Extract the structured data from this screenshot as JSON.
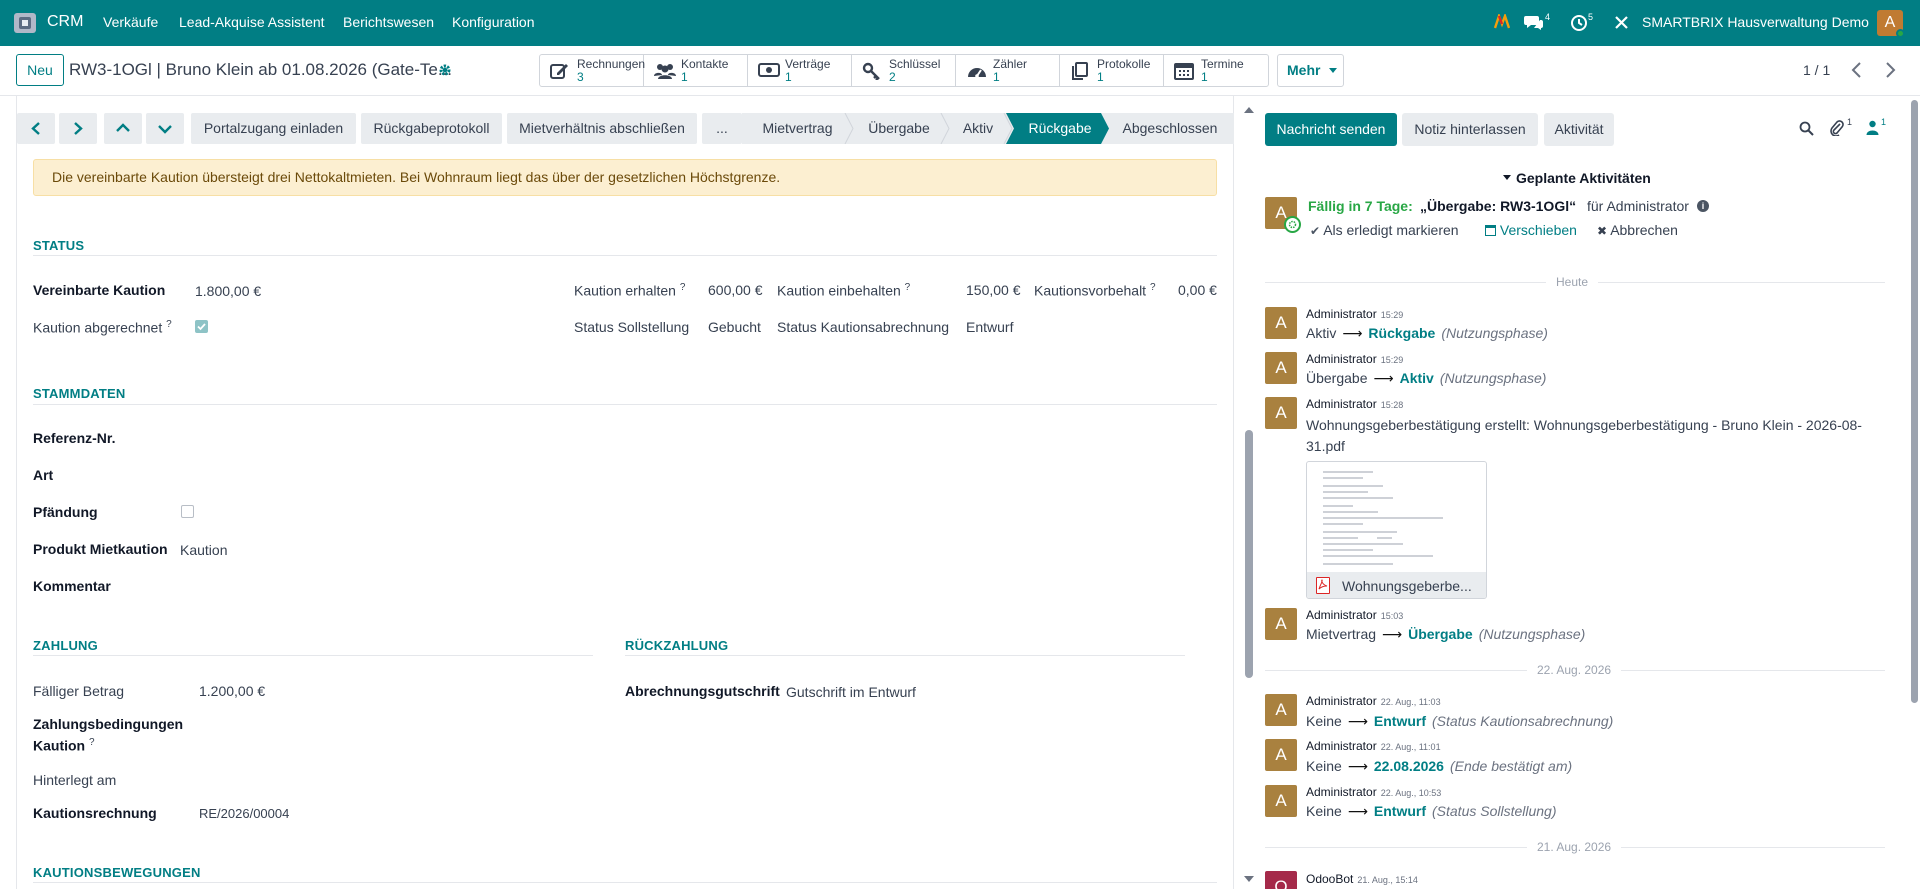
{
  "topbar": {
    "app": "CRM",
    "menu": [
      "Verkäufe",
      "Lead-Akquise Assistent",
      "Berichtswesen",
      "Konfiguration"
    ],
    "messages_count": "4",
    "activities_count": "5",
    "company": "SMARTBRIX Hausverwaltung Demo",
    "user_initial": "A",
    "accent": "#017e84"
  },
  "control_panel": {
    "new_label": "Neu",
    "breadcrumb": "RW3-1OGl | Bruno Klein ab 01.08.2026 (Gate-Te...",
    "smart_buttons": [
      {
        "icon": "pencil-square-icon",
        "label": "Rechnungen",
        "value": "3"
      },
      {
        "icon": "users-icon",
        "label": "Kontakte",
        "value": "1"
      },
      {
        "icon": "money-icon",
        "label": "Verträge",
        "value": "1"
      },
      {
        "icon": "key-icon",
        "label": "Schlüssel",
        "value": "2"
      },
      {
        "icon": "gauge-icon",
        "label": "Zähler",
        "value": "1"
      },
      {
        "icon": "file-copy-icon",
        "label": "Protokolle",
        "value": "1"
      },
      {
        "icon": "calendar-icon",
        "label": "Termine",
        "value": "1"
      }
    ],
    "more_label": "Mehr",
    "pager": "1 / 1"
  },
  "statusbar": {
    "actions": [
      "Portalzugang einladen",
      "Rückgabeprotokoll",
      "Mietverhältnis abschließen",
      "..."
    ],
    "stages": [
      "Mietvertrag",
      "Übergabe",
      "Aktiv",
      "Rückgabe",
      "Abgeschlossen"
    ],
    "active_stage": "Rückgabe"
  },
  "form": {
    "alert": "Die vereinbarte Kaution übersteigt drei Nettokaltmieten. Bei Wohnraum liegt das über der gesetzlichen Höchstgrenze.",
    "status": {
      "title": "STATUS",
      "agreed_label": "Vereinbarte Kaution",
      "agreed_value": "1.800,00 €",
      "settled_label": "Kaution abgerechnet",
      "settled_checked": true,
      "received_label": "Kaution erhalten",
      "received_value": "600,00 €",
      "retained_label": "Kaution einbehalten",
      "retained_value": "150,00 €",
      "reserve_label": "Kautionsvorbehalt",
      "reserve_value": "0,00 €",
      "target_label": "Status Sollstellung",
      "target_value": "Gebucht",
      "settlement_label": "Status Kautionsabrechnung",
      "settlement_value": "Entwurf",
      "help": "?"
    },
    "master": {
      "title": "STAMMDATEN",
      "ref_label": "Referenz-Nr.",
      "type_label": "Art",
      "seizure_label": "Pfändung",
      "seizure_checked": false,
      "product_label": "Produkt Mietkaution",
      "product_value": "Kaution",
      "comment_label": "Kommentar"
    },
    "payment": {
      "title": "ZAHLUNG",
      "due_label": "Fälliger Betrag",
      "due_value": "1.200,00 €",
      "terms_label_1": "Zahlungsbedingungen",
      "terms_label_2": "Kaution",
      "deposited_label": "Hinterlegt am",
      "invoice_label": "Kautionsrechnung",
      "invoice_value": "RE/2026/00004"
    },
    "refund": {
      "title": "RÜCKZAHLUNG",
      "credit_label": "Abrechnungsgutschrift",
      "credit_value": "Gutschrift im Entwurf"
    },
    "movements_title": "KAUTIONSBEWEGUNGEN"
  },
  "chatter": {
    "send_label": "Nachricht senden",
    "note_label": "Notiz hinterlassen",
    "activity_label": "Aktivität",
    "attachments_count": "1",
    "followers_count": "1",
    "planned_title": "Geplante Aktivitäten",
    "planned": {
      "due": "Fällig in 7 Tage:",
      "summary": "„Übergabe: RW3-1OGl“",
      "assignee": "für Administrator",
      "done": "Als erledigt markieren",
      "reschedule": "Verschieben",
      "cancel": "Abbrechen"
    },
    "date_today": "Heute",
    "messages_today": [
      {
        "author": "Administrator",
        "time": "15:29",
        "old": "Aktiv",
        "new": "Rückgabe",
        "field": "(Nutzungsphase)"
      },
      {
        "author": "Administrator",
        "time": "15:29",
        "old": "Übergabe",
        "new": "Aktiv",
        "field": "(Nutzungsphase)"
      }
    ],
    "attachment_msg": {
      "author": "Administrator",
      "time": "15:28",
      "body_1": "Wohnungsgeberbestätigung erstellt: Wohnungsgeberbestätigung - Bruno Klein - 2026-08-",
      "body_2": "31.pdf",
      "file_name": "Wohnungsgeberbe..."
    },
    "msg_1503": {
      "author": "Administrator",
      "time": "15:03",
      "old": "Mietvertrag",
      "new": "Übergabe",
      "field": "(Nutzungsphase)"
    },
    "date_2": "22. Aug. 2026",
    "messages_aug22": [
      {
        "author": "Administrator",
        "time": "22. Aug., 11:03",
        "old": "Keine",
        "new": "Entwurf",
        "field": "(Status Kautionsabrechnung)"
      },
      {
        "author": "Administrator",
        "time": "22. Aug., 11:01",
        "old": "Keine",
        "new": "22.08.2026",
        "field": "(Ende bestätigt am)"
      },
      {
        "author": "Administrator",
        "time": "22. Aug., 10:53",
        "old": "Keine",
        "new": "Entwurf",
        "field": "(Status Sollstellung)"
      }
    ],
    "date_3": "21. Aug. 2026",
    "odoobot": {
      "author": "OdooBot",
      "time": "21. Aug., 15:14",
      "initial": "O"
    }
  }
}
